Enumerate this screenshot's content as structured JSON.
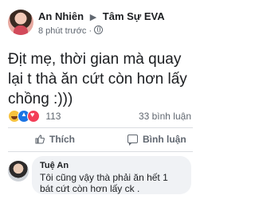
{
  "post": {
    "author": "An Nhiên",
    "arrow": "▶",
    "group": "Tâm Sự EVA",
    "time": "8 phút trước",
    "separator": "·",
    "privacy_icon": "globe-icon",
    "more": "···",
    "text": "Địt mẹ, thời gian mà quay lại t thà ăn cứt còn hơn lấy chồng :)))"
  },
  "reactions": {
    "icons": [
      "haha-icon",
      "like-icon",
      "love-icon"
    ],
    "count": "113",
    "comments": "33 bình luận"
  },
  "actions": {
    "like_label": "Thích",
    "comment_label": "Bình luận"
  },
  "comment": {
    "author": "Tuệ An",
    "text": "Tôi cũng vậy thà phải ăn hết 1 bát cứt còn hơn lấy ck ."
  },
  "colors": {
    "text": "#1c1e21",
    "muted": "#606770",
    "bubble": "#f0f2f5",
    "divider": "#dadde1",
    "like_blue": "#1b74e4",
    "love_red": "#f33e58",
    "haha_yellow": "#f7c23d"
  }
}
